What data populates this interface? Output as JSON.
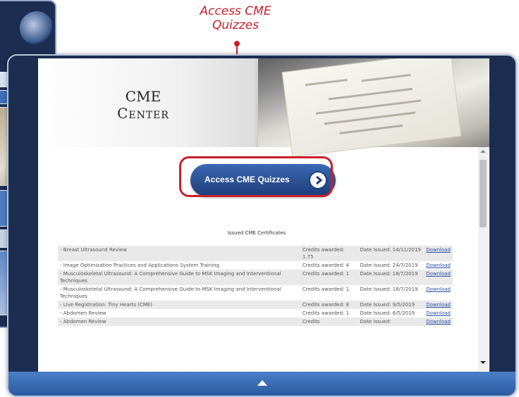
{
  "callout": {
    "label": "Access CME Quizzes"
  },
  "banner": {
    "title_line1": "CME",
    "title_line2": "Center"
  },
  "cta": {
    "label": "Access CME Quizzes"
  },
  "certificates": {
    "heading": "Issued CME Certificates",
    "rows": [
      {
        "name": "- Breast Ultrasound Review",
        "credits": "Credits awarded: 1.75",
        "date": "Date Issued: 14/11/2019",
        "action": "Download"
      },
      {
        "name": "- Image Optimization Practices and Applications System Training",
        "credits": "Credits awarded: 4",
        "date": "Date Issued: 24/7/2019",
        "action": "Download"
      },
      {
        "name": "- Musculoskeletal Ultrasound: A Comprehensive Guide to MSK Imaging and Interventional Techniques",
        "credits": "Credits awarded: 1",
        "date": "Date Issued: 18/7/2019",
        "action": "Download"
      },
      {
        "name": "- Musculoskeletal Ultrasound: A Comprehensive Guide to MSK Imaging and Interventional Techniques",
        "credits": "Credits awarded: 1",
        "date": "Date Issued: 18/7/2019",
        "action": "Download"
      },
      {
        "name": "- Live Registration: Tiny Hearts (CME)",
        "credits": "Credits awarded: 8",
        "date": "Date Issued: 9/5/2019",
        "action": "Download"
      },
      {
        "name": "- Abdomen Review",
        "credits": "Credits awarded: 1",
        "date": "Date Issued: 6/5/2019",
        "action": "Download"
      },
      {
        "name": "- Abdomen Review",
        "credits": "Credits",
        "date": "Date Issued:",
        "action": "Download"
      }
    ]
  },
  "colors": {
    "accent": "#c8202a",
    "frame": "#1c2d52",
    "button": "#1e3d7a"
  }
}
